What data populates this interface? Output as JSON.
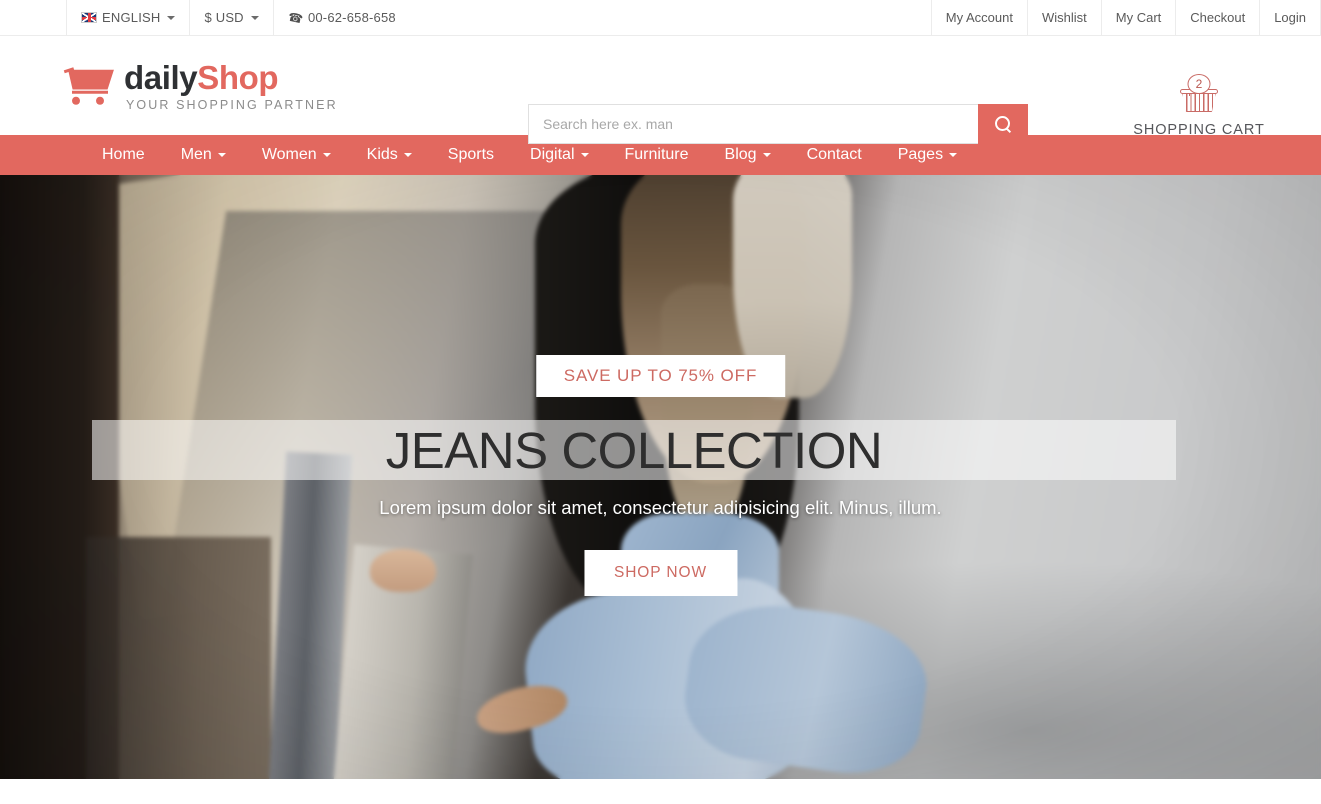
{
  "topbar": {
    "language": {
      "label": "ENGLISH",
      "icon": "uk-flag-icon"
    },
    "currency": {
      "label": "$ USD"
    },
    "phone": {
      "label": "00-62-658-658",
      "icon": "phone-icon"
    },
    "links": [
      {
        "label": "My Account"
      },
      {
        "label": "Wishlist"
      },
      {
        "label": "My Cart"
      },
      {
        "label": "Checkout"
      },
      {
        "label": "Login"
      }
    ]
  },
  "header": {
    "logo": {
      "primary": "daily",
      "accent": "Shop",
      "tagline": "YOUR SHOPPING PARTNER",
      "icon": "shopping-cart-icon"
    },
    "search": {
      "placeholder": "Search here ex. man",
      "value": "",
      "button_icon": "search-icon"
    },
    "cart": {
      "count": "2",
      "label": "SHOPPING CART",
      "icon": "basket-icon"
    }
  },
  "nav": {
    "items": [
      {
        "label": "Home",
        "has_dropdown": false
      },
      {
        "label": "Men",
        "has_dropdown": true
      },
      {
        "label": "Women",
        "has_dropdown": true
      },
      {
        "label": "Kids",
        "has_dropdown": true
      },
      {
        "label": "Sports",
        "has_dropdown": false
      },
      {
        "label": "Digital",
        "has_dropdown": true
      },
      {
        "label": "Furniture",
        "has_dropdown": false
      },
      {
        "label": "Blog",
        "has_dropdown": true
      },
      {
        "label": "Contact",
        "has_dropdown": false
      },
      {
        "label": "Pages",
        "has_dropdown": true
      }
    ]
  },
  "hero": {
    "badge": "SAVE UP TO 75% OFF",
    "title": "JEANS COLLECTION",
    "subtitle": "Lorem ipsum dolor sit amet, consectetur adipisicing elit. Minus, illum.",
    "cta": "SHOP NOW"
  },
  "colors": {
    "accent": "#e2685f",
    "accent_text": "#cd6a62",
    "nav_bg": "#e2685f",
    "logo_dark": "#2f3134",
    "topbar_text": "#5a5a5a",
    "hero_title": "#2e2e2e"
  }
}
